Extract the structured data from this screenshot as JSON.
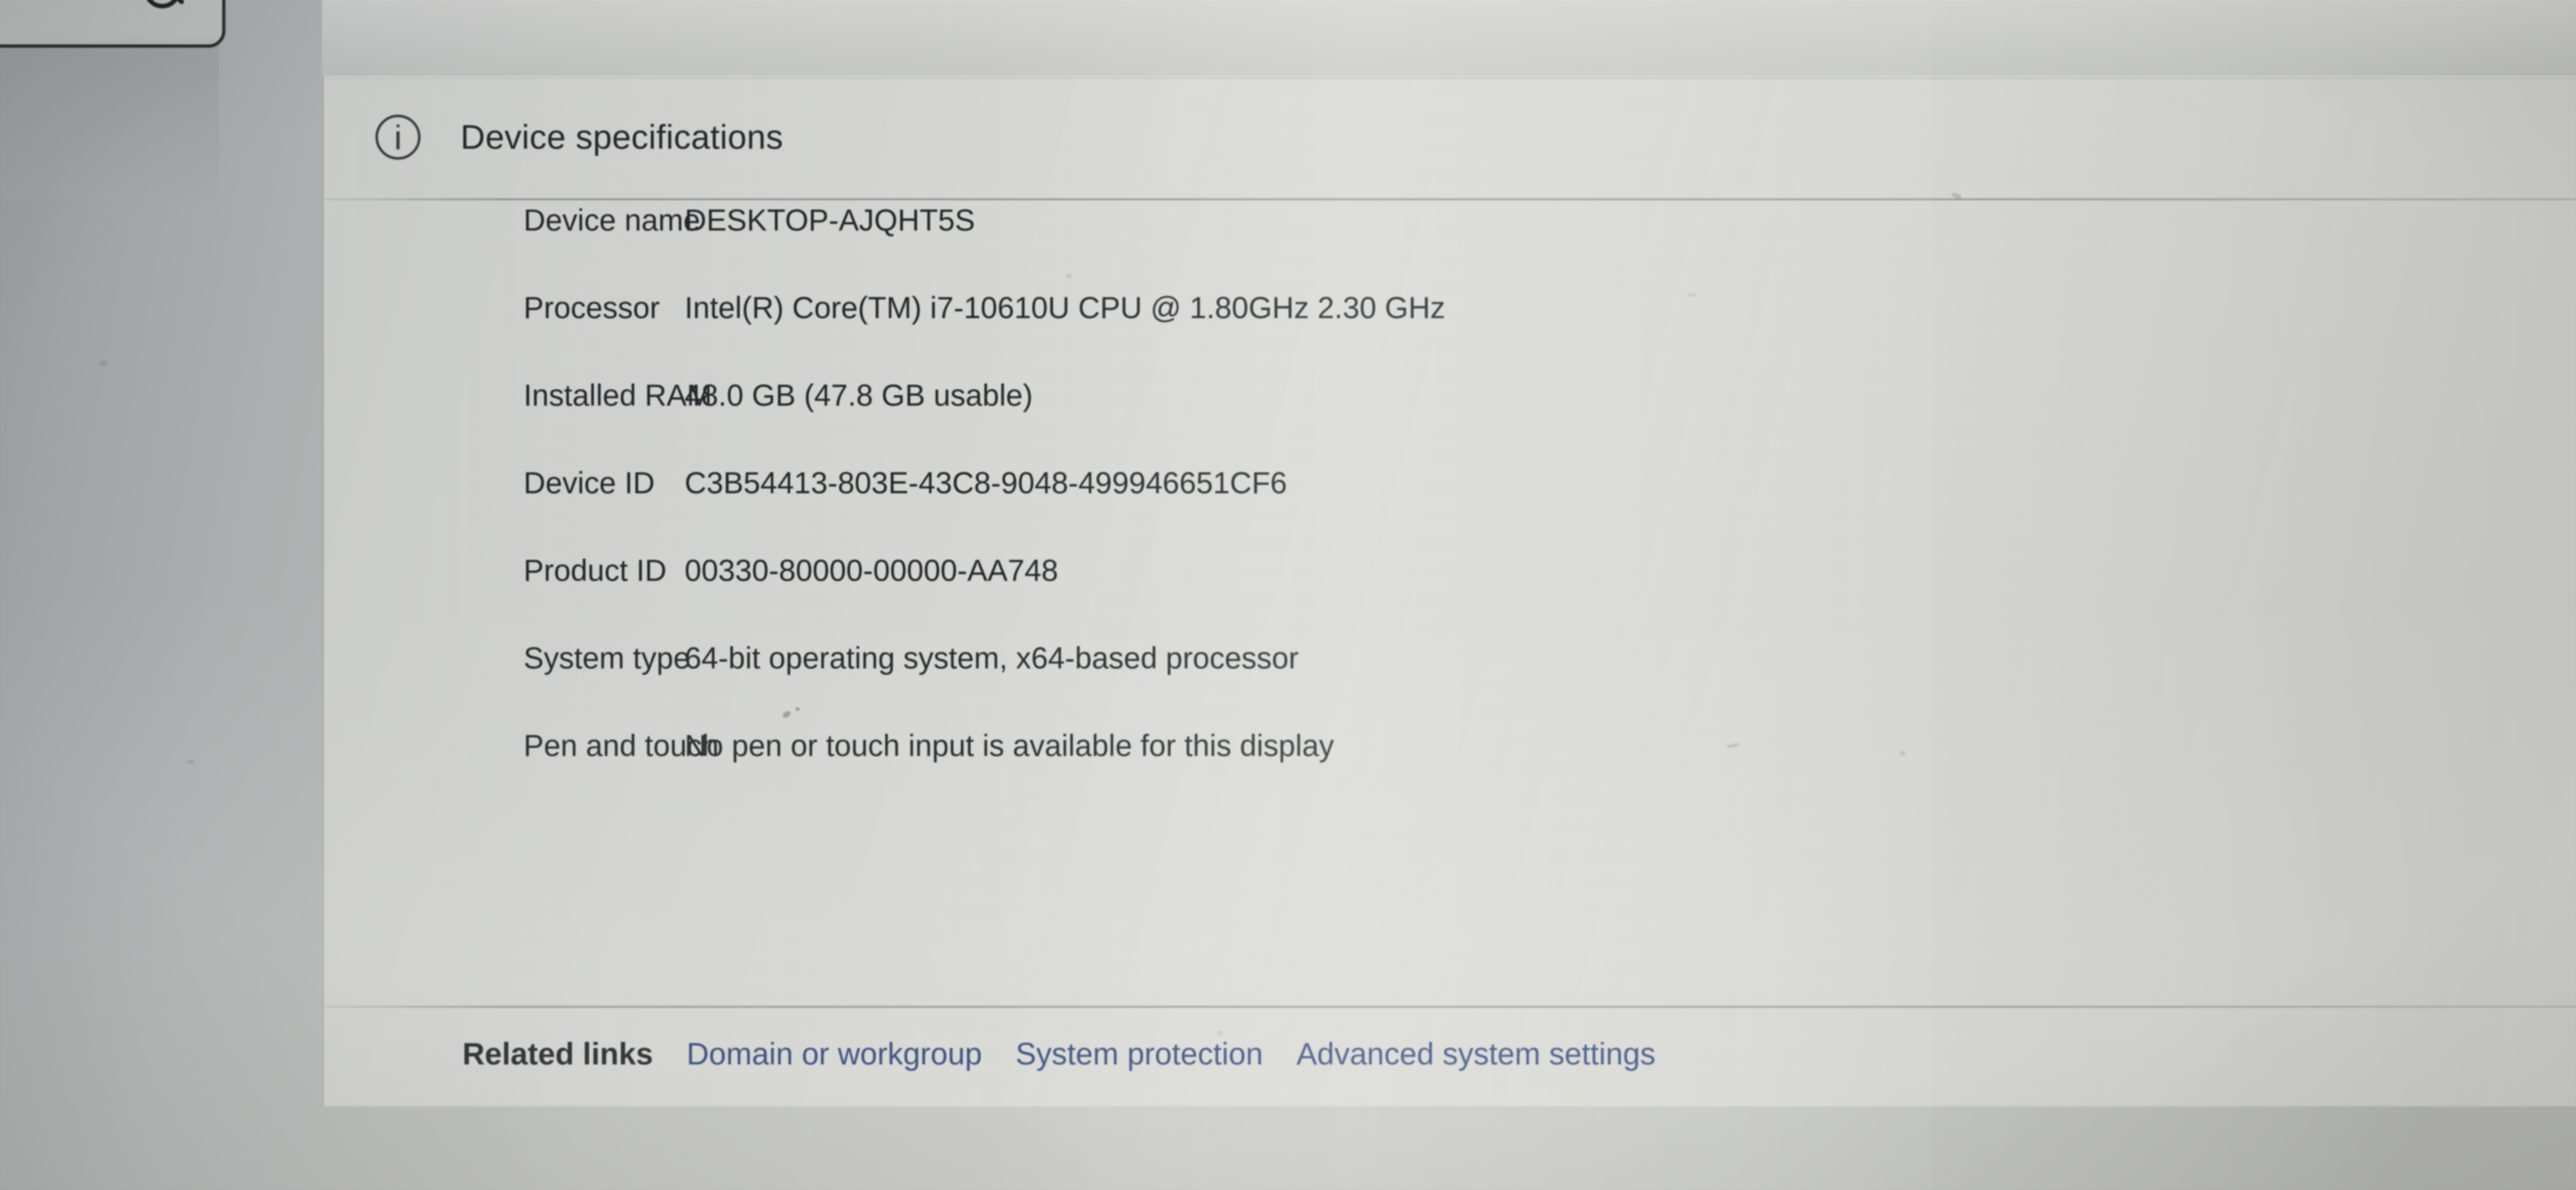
{
  "window": {
    "search_placeholder": "",
    "search_icon": "search-icon"
  },
  "card": {
    "icon": "info-circle-icon",
    "title": "Device specifications"
  },
  "specs": [
    {
      "label": "Device name",
      "value": "DESKTOP-AJQHT5S"
    },
    {
      "label": "Processor",
      "value": "Intel(R) Core(TM) i7-10610U CPU @ 1.80GHz   2.30 GHz"
    },
    {
      "label": "Installed RAM",
      "value": "48.0 GB (47.8 GB usable)"
    },
    {
      "label": "Device ID",
      "value": "C3B54413-803E-43C8-9048-499946651CF6"
    },
    {
      "label": "Product ID",
      "value": "00330-80000-00000-AA748"
    },
    {
      "label": "System type",
      "value": "64-bit operating system, x64-based processor"
    },
    {
      "label": "Pen and touch",
      "value": "No pen or touch input is available for this display"
    }
  ],
  "related": {
    "title": "Related links",
    "links": [
      {
        "label": "Domain or workgroup"
      },
      {
        "label": "System protection"
      },
      {
        "label": "Advanced system settings"
      }
    ]
  },
  "colors": {
    "link": "#26437a",
    "text": "#23272b",
    "panel": "#e6e6e1",
    "divider": "#74787a"
  }
}
